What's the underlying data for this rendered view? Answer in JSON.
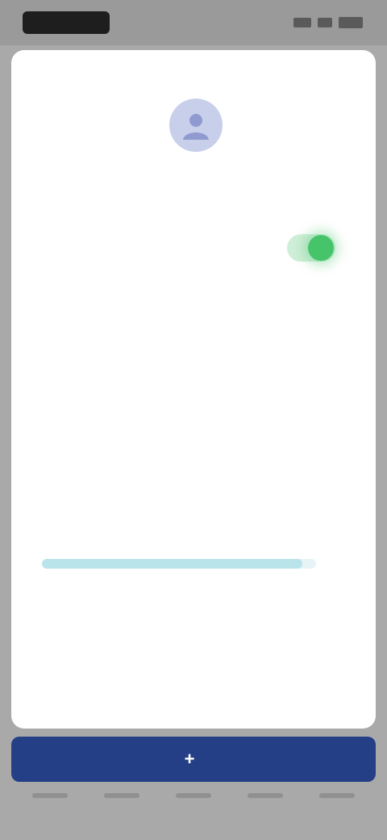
{
  "status_bar": {
    "time": "",
    "icons": [
      "signal-icon",
      "wifi-icon",
      "battery-icon"
    ]
  },
  "profile": {
    "avatar_icon": "user-icon",
    "name": ""
  },
  "settings": {
    "toggle_row": {
      "label": "",
      "enabled": true
    },
    "rows": [
      {
        "label": "",
        "value": ""
      },
      {
        "label": "",
        "value": ""
      },
      {
        "label": "",
        "value": ""
      }
    ],
    "progress_row": {
      "label": "",
      "count": "",
      "fraction": 0.95
    }
  },
  "action_bar": {
    "icon": "plus-icon",
    "label": ""
  },
  "colors": {
    "accent": "#243f86",
    "toggle_on": "#45c46a",
    "progress": "#b9e4ea",
    "avatar_bg": "#c8cfea"
  }
}
